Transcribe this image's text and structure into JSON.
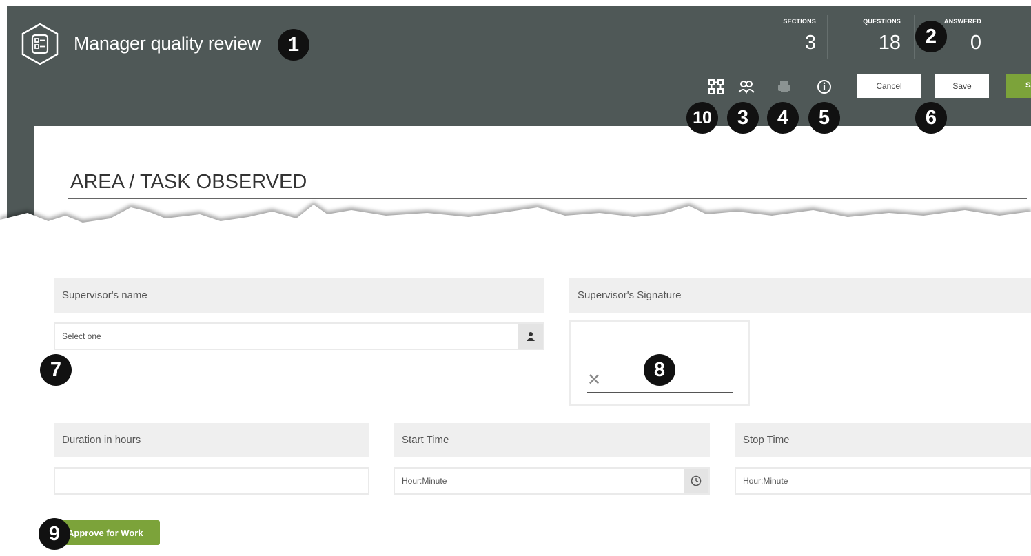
{
  "header": {
    "title": "Manager quality review",
    "stats": [
      {
        "label": "SECTIONS",
        "value": "3"
      },
      {
        "label": "QUESTIONS",
        "value": "18"
      },
      {
        "label": "ANSWERED",
        "value": "0"
      }
    ],
    "toolbar": {
      "icons": [
        "workflow-icon",
        "users-icon",
        "print-icon",
        "info-icon"
      ],
      "cancel_label": "Cancel",
      "save_label": "Save",
      "submit_label_partial": "Sa"
    }
  },
  "section": {
    "title": "AREA / TASK OBSERVED"
  },
  "form": {
    "supervisor_name": {
      "label": "Supervisor's name",
      "placeholder": "Select one"
    },
    "supervisor_signature": {
      "label": "Supervisor's Signature",
      "sign_mark": "✕"
    },
    "duration": {
      "label": "Duration in hours",
      "value": ""
    },
    "start_time": {
      "label": "Start Time",
      "placeholder": "Hour:Minute"
    },
    "stop_time": {
      "label": "Stop Time",
      "placeholder": "Hour:Minute"
    },
    "approve_label": "Approve for Work"
  },
  "callouts": {
    "c1": "1",
    "c2": "2",
    "c3": "3",
    "c4": "4",
    "c5": "5",
    "c6": "6",
    "c7": "7",
    "c8": "8",
    "c9": "9",
    "c10": "10"
  },
  "colors": {
    "header_bg": "#4f5857",
    "accent_green": "#7ca33a",
    "label_bg": "#efefef"
  }
}
